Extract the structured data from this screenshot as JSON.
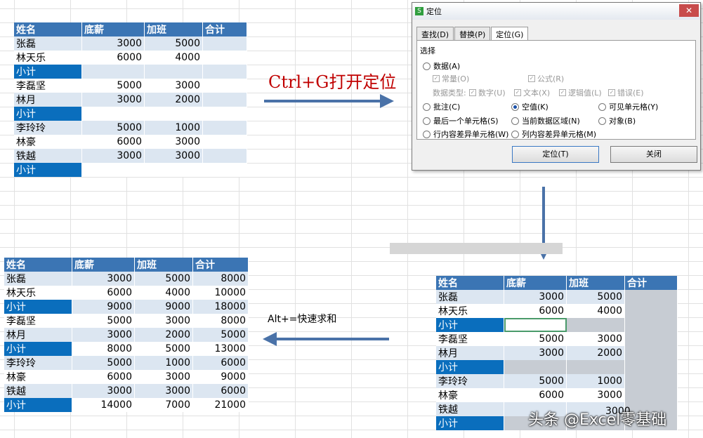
{
  "header": [
    "姓名",
    "底薪",
    "加班",
    "合计"
  ],
  "table1": [
    [
      "张磊",
      "3000",
      "5000",
      ""
    ],
    [
      "林天乐",
      "6000",
      "4000",
      ""
    ],
    [
      "小计",
      "",
      "",
      ""
    ],
    [
      "李磊坚",
      "5000",
      "3000",
      ""
    ],
    [
      "林月",
      "3000",
      "2000",
      ""
    ],
    [
      "小计",
      "",
      "",
      ""
    ],
    [
      "李玲玲",
      "5000",
      "1000",
      ""
    ],
    [
      "林豪",
      "6000",
      "3000",
      ""
    ],
    [
      "铁越",
      "3000",
      "3000",
      ""
    ],
    [
      "小计",
      "",
      "",
      ""
    ]
  ],
  "table3": [
    [
      "张磊",
      "3000",
      "5000",
      "8000"
    ],
    [
      "林天乐",
      "6000",
      "4000",
      "10000"
    ],
    [
      "小计",
      "9000",
      "9000",
      "18000"
    ],
    [
      "李磊坚",
      "5000",
      "3000",
      "8000"
    ],
    [
      "林月",
      "3000",
      "2000",
      "5000"
    ],
    [
      "小计",
      "8000",
      "5000",
      "13000"
    ],
    [
      "李玲玲",
      "5000",
      "1000",
      "6000"
    ],
    [
      "林豪",
      "6000",
      "3000",
      "9000"
    ],
    [
      "铁越",
      "3000",
      "3000",
      "6000"
    ],
    [
      "小计",
      "14000",
      "7000",
      "21000"
    ]
  ],
  "table2": [
    [
      "张磊",
      "3000",
      "5000",
      ""
    ],
    [
      "林天乐",
      "6000",
      "4000",
      ""
    ],
    [
      "小计",
      "",
      "",
      ""
    ],
    [
      "李磊坚",
      "5000",
      "3000",
      ""
    ],
    [
      "林月",
      "3000",
      "2000",
      ""
    ],
    [
      "小计",
      "",
      "",
      ""
    ],
    [
      "李玲玲",
      "5000",
      "1000",
      ""
    ],
    [
      "林豪",
      "6000",
      "3000",
      ""
    ],
    [
      "铁越",
      "",
      "",
      ""
    ],
    [
      "小计",
      "",
      "",
      ""
    ]
  ],
  "note_ctrlg": "Ctrl+G打开定位",
  "note_alt": "Alt+=快速求和",
  "dialog": {
    "title": "定位",
    "close": "✕",
    "tabs": [
      "查找(D)",
      "替换(P)",
      "定位(G)"
    ],
    "section": "选择",
    "opt_data": "数据(A)",
    "opt_const": "常量(O)",
    "opt_formula": "公式(R)",
    "type_label": "数据类型:",
    "t_num": "数字(U)",
    "t_text": "文本(X)",
    "t_logic": "逻辑值(L)",
    "t_err": "错误(E)",
    "opt_comment": "批注(C)",
    "opt_blank": "空值(K)",
    "opt_visible": "可见单元格(Y)",
    "opt_last": "最后一个单元格(S)",
    "opt_region": "当前数据区域(N)",
    "opt_obj": "对象(B)",
    "opt_rowdiff": "行内容差异单元格(W)",
    "opt_coldiff": "列内容差异单元格(M)",
    "btn_locate": "定位(T)",
    "btn_close": "关闭"
  },
  "partial": "3000",
  "watermark": "头条 @Excel零基础"
}
